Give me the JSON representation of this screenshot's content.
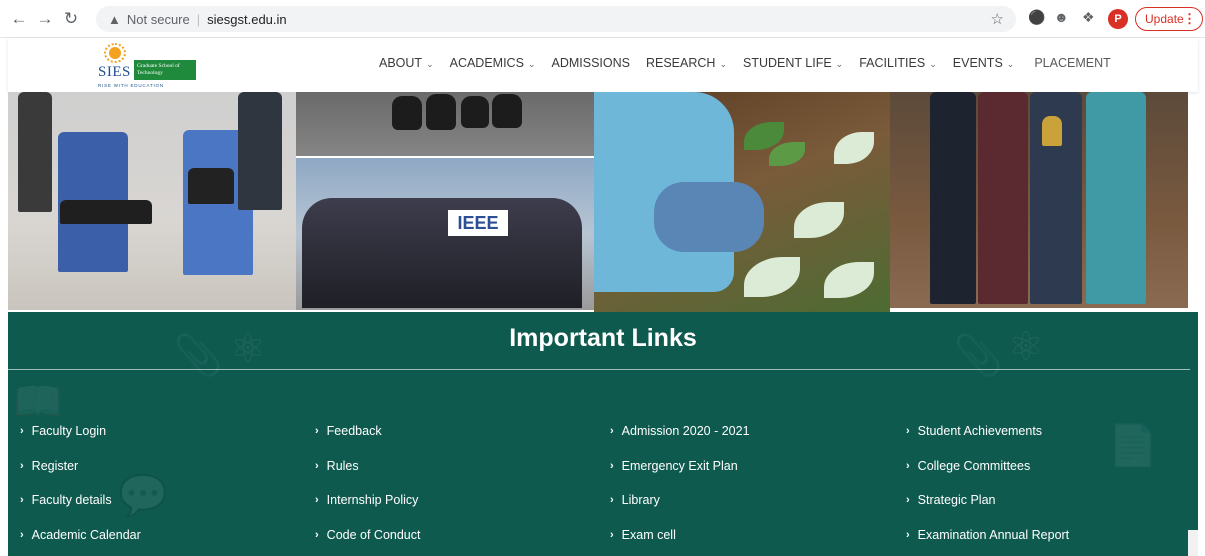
{
  "browser": {
    "security_label": "Not secure",
    "separator": "|",
    "url": "siesgst.edu.in",
    "avatar_letter": "P",
    "update_label": "Update",
    "icons": [
      "back-arrow-icon",
      "forward-arrow-icon",
      "reload-icon",
      "warning-icon",
      "star-icon",
      "extension-icon",
      "puzzle-icon",
      "kebab-menu-icon"
    ]
  },
  "logo": {
    "wordmark": "SIES",
    "box_text": "Graduate School of Technology",
    "tagline": "RISE WITH EDUCATION"
  },
  "menu": [
    {
      "label": "ABOUT",
      "dropdown": true
    },
    {
      "label": "ACADEMICS",
      "dropdown": true
    },
    {
      "label": "ADMISSIONS",
      "dropdown": false
    },
    {
      "label": "RESEARCH",
      "dropdown": true
    },
    {
      "label": "STUDENT LIFE",
      "dropdown": true
    },
    {
      "label": "FACILITIES",
      "dropdown": true
    },
    {
      "label": "EVENTS",
      "dropdown": true
    },
    {
      "label": "PLACEMENT",
      "dropdown": false
    }
  ],
  "photos": {
    "banner_text": "IEEE"
  },
  "important_links": {
    "title": "Important Links",
    "columns": [
      [
        "Faculty Login",
        "Register",
        "Faculty details",
        "Academic Calendar"
      ],
      [
        "Feedback",
        "Rules",
        "Internship Policy",
        "Code of Conduct"
      ],
      [
        "Admission 2020 - 2021",
        "Emergency Exit Plan",
        "Library",
        "Exam cell"
      ],
      [
        "Student Achievements",
        "College Committees",
        "Strategic Plan",
        "Examination Annual Report"
      ]
    ]
  },
  "colors": {
    "links_bg": "#0f5a4f",
    "update_red": "#d93025",
    "logo_blue": "#1d4f91",
    "logo_green": "#1f8a3c"
  }
}
